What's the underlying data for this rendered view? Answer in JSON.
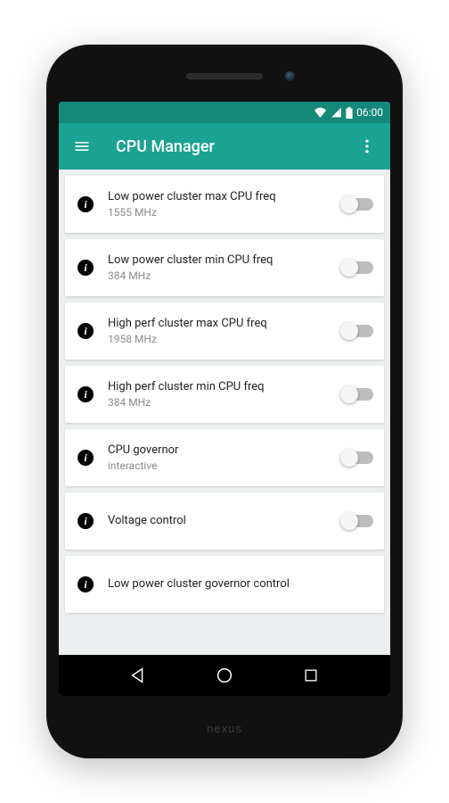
{
  "status": {
    "time": "06:00"
  },
  "app": {
    "title": "CPU Manager"
  },
  "items": [
    {
      "title": "Low power cluster max CPU freq",
      "subtitle": "1555 MHz",
      "hasSwitch": true
    },
    {
      "title": "Low power cluster min CPU freq",
      "subtitle": "384 MHz",
      "hasSwitch": true
    },
    {
      "title": "High perf cluster max CPU freq",
      "subtitle": "1958 MHz",
      "hasSwitch": true
    },
    {
      "title": "High perf cluster min CPU freq",
      "subtitle": "384 MHz",
      "hasSwitch": true
    },
    {
      "title": "CPU governor",
      "subtitle": "interactive",
      "hasSwitch": true
    },
    {
      "title": "Voltage control",
      "subtitle": "",
      "hasSwitch": true
    },
    {
      "title": "Low power cluster governor control",
      "subtitle": "",
      "hasSwitch": false
    }
  ],
  "device": {
    "brand": "nexus"
  }
}
